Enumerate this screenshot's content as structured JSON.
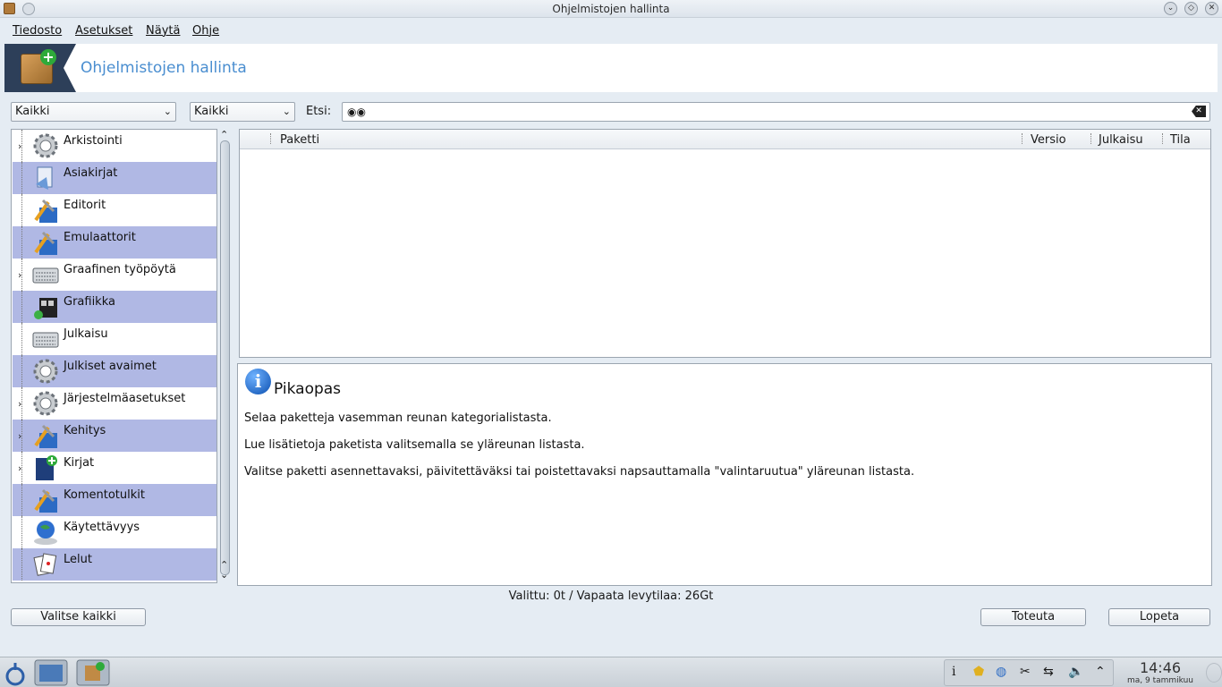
{
  "window": {
    "title": "Ohjelmistojen hallinta"
  },
  "menu": {
    "items": [
      "Tiedosto",
      "Asetukset",
      "Näytä",
      "Ohje"
    ]
  },
  "header": {
    "title": "Ohjelmistojen hallinta"
  },
  "filters": {
    "type_selected": "Kaikki",
    "state_selected": "Kaikki",
    "search_label": "Etsi:",
    "search_value": ""
  },
  "categories": [
    {
      "label": "Arkistointi",
      "icon": "gear-icon",
      "expandable": true
    },
    {
      "label": "Asiakirjat",
      "icon": "document-icon",
      "expandable": false
    },
    {
      "label": "Editorit",
      "icon": "tools-icon",
      "expandable": false
    },
    {
      "label": "Emulaattorit",
      "icon": "tools-icon",
      "expandable": false
    },
    {
      "label": "Graafinen työpöytä",
      "icon": "keyboard-icon",
      "expandable": true
    },
    {
      "label": "Grafiikka",
      "icon": "film-icon",
      "expandable": false
    },
    {
      "label": "Julkaisu",
      "icon": "keyboard-icon",
      "expandable": false
    },
    {
      "label": "Julkiset avaimet",
      "icon": "gear-icon",
      "expandable": false
    },
    {
      "label": "Järjestelmäasetukset",
      "icon": "gear-icon",
      "expandable": true
    },
    {
      "label": "Kehitys",
      "icon": "tools-icon",
      "expandable": true
    },
    {
      "label": "Kirjat",
      "icon": "book-icon",
      "expandable": true
    },
    {
      "label": "Komentotulkit",
      "icon": "tools-icon",
      "expandable": false
    },
    {
      "label": "Käytettävyys",
      "icon": "globe-icon",
      "expandable": false
    },
    {
      "label": "Lelut",
      "icon": "cards-icon",
      "expandable": false
    }
  ],
  "table": {
    "columns": [
      "Paketti",
      "Versio",
      "Julkaisu",
      "Tila"
    ]
  },
  "info": {
    "title": "Pikaopas",
    "lines": [
      "Selaa paketteja vasemman reunan kategorialistasta.",
      "Lue lisätietoja paketista valitsemalla se yläreunan listasta.",
      "Valitse paketti asennettavaksi, päivitettäväksi tai poistettavaksi napsauttamalla \"valintaruutua\" yläreunan listasta."
    ]
  },
  "status": "Valittu: 0t / Vapaata levytilaa: 26Gt",
  "buttons": {
    "select_all": "Valitse kaikki",
    "apply": "Toteuta",
    "quit": "Lopeta"
  },
  "taskbar": {
    "tray_info": "i",
    "clock_time": "14:46",
    "clock_date": "ma, 9 tammikuu"
  }
}
